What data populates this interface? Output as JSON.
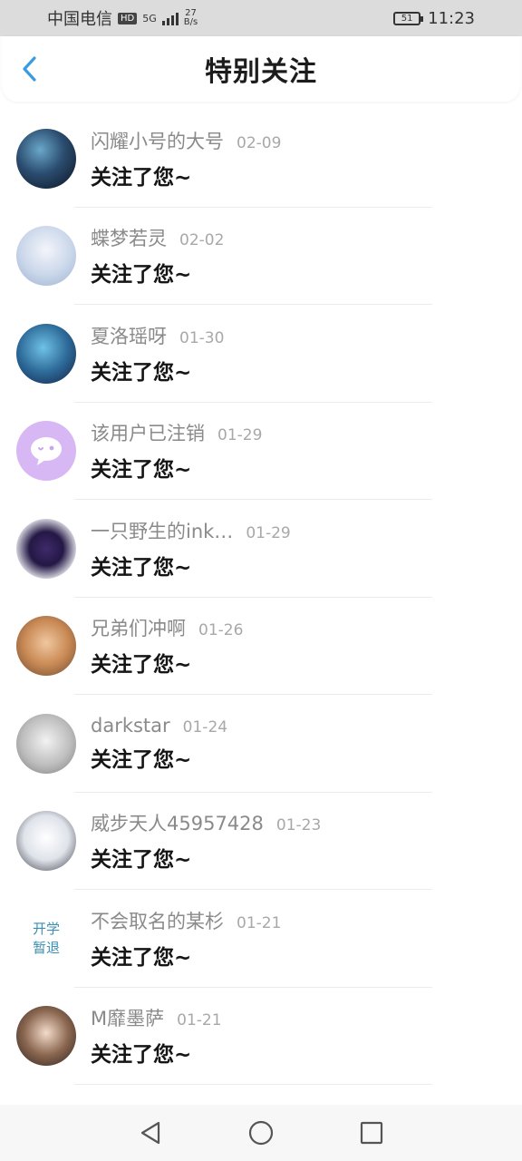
{
  "status_bar": {
    "carrier": "中国电信",
    "hd": "HD",
    "network": "5G",
    "speed_value": "27",
    "speed_unit": "B/s",
    "battery": "51",
    "time": "11:23"
  },
  "header": {
    "title": "特别关注"
  },
  "items": [
    {
      "username": "闪耀小号的大号",
      "date": "02-09",
      "message": "关注了您~",
      "avatar": "anime-avatar"
    },
    {
      "username": "蝶梦若灵",
      "date": "02-02",
      "message": "关注了您~",
      "avatar": "anime-avatar"
    },
    {
      "username": "夏洛瑶呀",
      "date": "01-30",
      "message": "关注了您~",
      "avatar": "anime-avatar"
    },
    {
      "username": "该用户已注销",
      "date": "01-29",
      "message": "关注了您~",
      "avatar": "chat-bubble-icon"
    },
    {
      "username": "一只野生的ink…",
      "date": "01-29",
      "message": "关注了您~",
      "avatar": "anime-avatar"
    },
    {
      "username": "兄弟们冲啊",
      "date": "01-26",
      "message": "关注了您~",
      "avatar": "cat-photo"
    },
    {
      "username": "darkstar",
      "date": "01-24",
      "message": "关注了您~",
      "avatar": "sketch-avatar"
    },
    {
      "username": "威步天人45957428",
      "date": "01-23",
      "message": "关注了您~",
      "avatar": "anime-avatar"
    },
    {
      "username": "不会取名的某杉",
      "date": "01-21",
      "message": "关注了您~",
      "avatar_text_1": "开学",
      "avatar_text_2": "暂退"
    },
    {
      "username": "M靡墨萨",
      "date": "01-21",
      "message": "关注了您~",
      "avatar": "anime-avatar"
    }
  ],
  "colors": {
    "accent": "#3b9be0",
    "username": "#8a8a8a",
    "message": "#151515",
    "avatar_text": "#3a8fb3"
  }
}
